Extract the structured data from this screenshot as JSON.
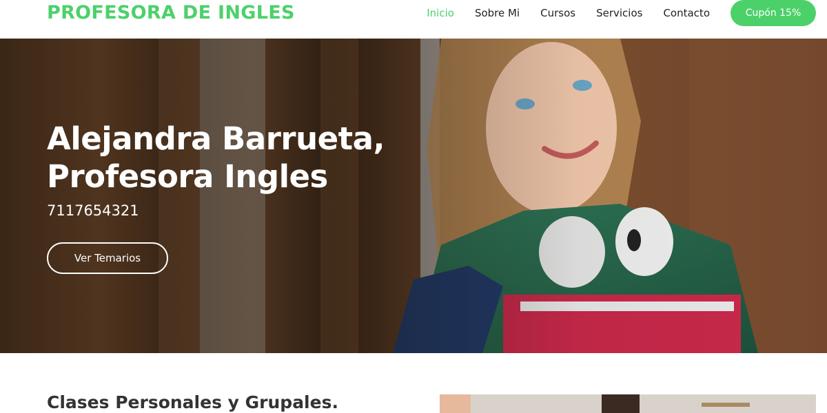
{
  "brand": {
    "logo_text": "PROFESORA DE INGLES"
  },
  "nav": {
    "items": [
      {
        "label": "Inicio",
        "active": true
      },
      {
        "label": "Sobre Mi",
        "active": false
      },
      {
        "label": "Cursos",
        "active": false
      },
      {
        "label": "Servicios",
        "active": false
      },
      {
        "label": "Contacto",
        "active": false
      }
    ],
    "cta_label": "Cupón 15%"
  },
  "hero": {
    "title_line1": "Alejandra Barrueta,",
    "title_line2": "Profesora Ingles",
    "phone": "7117654321",
    "button_label": "Ver Temarios",
    "image_subject": "student-girl-with-headphones-photo"
  },
  "section": {
    "title": "Clases Personales y Grupales.",
    "image_subject": "class-photo"
  },
  "colors": {
    "accent": "#4cd16a",
    "text": "#222222",
    "hero_text": "#ffffff"
  }
}
